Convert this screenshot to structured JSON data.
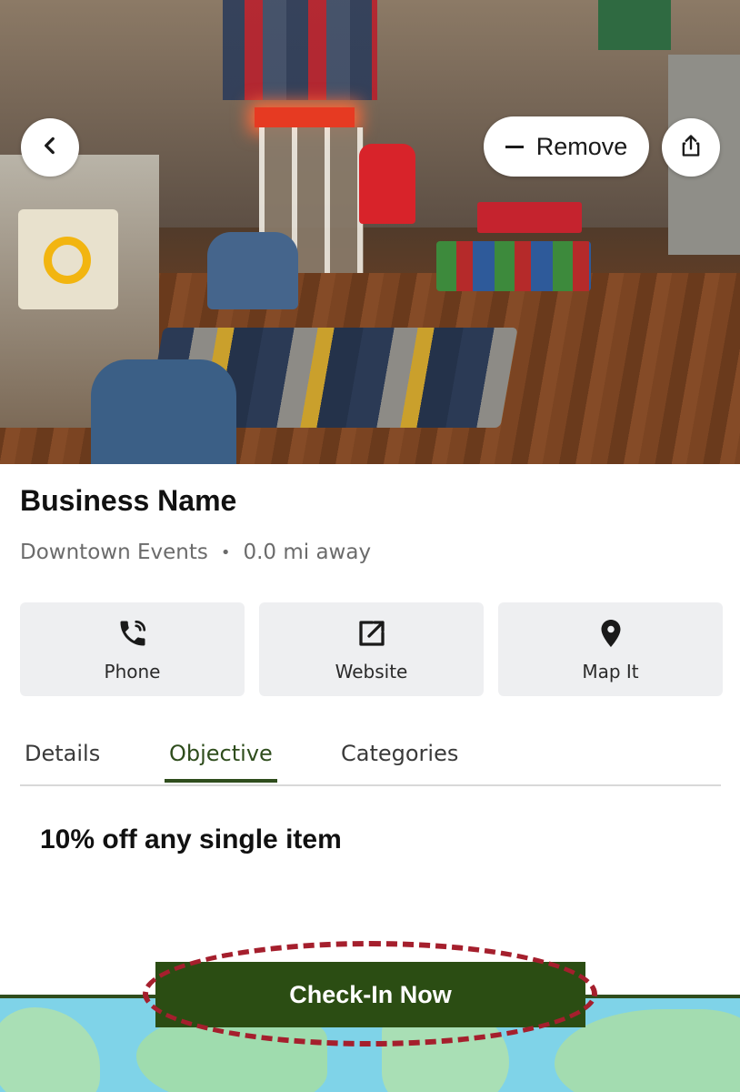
{
  "header": {
    "remove_label": "Remove"
  },
  "business": {
    "name": "Business Name",
    "category": "Downtown Events",
    "separator": "•",
    "distance": "0.0 mi away"
  },
  "actions": [
    {
      "label": "Phone",
      "icon": "phone-icon"
    },
    {
      "label": "Website",
      "icon": "external-link-icon"
    },
    {
      "label": "Map It",
      "icon": "map-pin-icon"
    }
  ],
  "tabs": [
    {
      "label": "Details",
      "active": false
    },
    {
      "label": "Objective",
      "active": true
    },
    {
      "label": "Categories",
      "active": false
    }
  ],
  "objective": {
    "text": "10% off any single item"
  },
  "cta": {
    "label": "Check-In Now"
  },
  "colors": {
    "brand_green": "#2b4d13",
    "highlight_red": "#a51f2d"
  }
}
